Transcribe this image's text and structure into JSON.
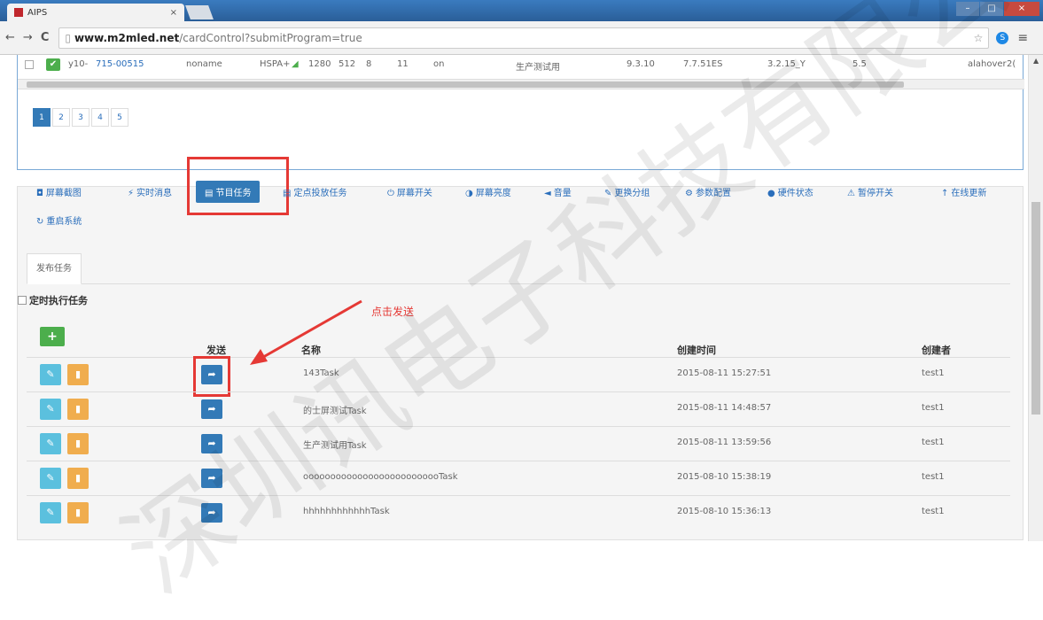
{
  "browser": {
    "tab_title": "AIPS",
    "tab_close": "×",
    "url_domain": "www.m2mled.net",
    "url_path": "/cardControl?submitProgram=true",
    "back": "←",
    "forward": "→",
    "reload": "C",
    "star": "☆",
    "menu": "≡"
  },
  "device_row": {
    "id": "y10-",
    "link": "715-00515",
    "name": "noname",
    "network": "HSPA+",
    "w": "1280",
    "h": "512",
    "n1": "8",
    "n2": "11",
    "state": "on",
    "group": "生产测试用",
    "v1": "9.3.10",
    "v2": "7.7.51ES",
    "v3": "3.2.15_Y",
    "v4": "5.5",
    "user": "alahover",
    "trunc": "2("
  },
  "pager": [
    "1",
    "2",
    "3",
    "4",
    "5"
  ],
  "actions": [
    {
      "icon": "◘",
      "label": "屏幕截图"
    },
    {
      "icon": "⚡",
      "label": "实时消息"
    },
    {
      "icon": "▤",
      "label": "节目任务"
    },
    {
      "icon": "▤",
      "label": "定点投放任务"
    },
    {
      "icon": "⏻",
      "label": "屏幕开关"
    },
    {
      "icon": "◑",
      "label": "屏幕亮度"
    },
    {
      "icon": "◄",
      "label": "音量"
    },
    {
      "icon": "✎",
      "label": "更换分组"
    },
    {
      "icon": "⚙",
      "label": "参数配置"
    },
    {
      "icon": "●",
      "label": "硬件状态"
    },
    {
      "icon": "⚠",
      "label": "暂停开关"
    },
    {
      "icon": "↑",
      "label": "在线更新"
    },
    {
      "icon": "↻",
      "label": "重启系统"
    }
  ],
  "inner_tab": "发布任务",
  "timer_checkbox": "定时执行任务",
  "annotation": "点击发送",
  "table": {
    "add_label": "+",
    "headers": {
      "send": "发送",
      "name": "名称",
      "created": "创建时间",
      "creator": "创建者"
    },
    "rows": [
      {
        "name": "143Task",
        "created": "2015-08-11 15:27:51",
        "creator": "test1"
      },
      {
        "name": "的士屏测试Task",
        "created": "2015-08-11 14:48:57",
        "creator": "test1"
      },
      {
        "name": "生产测试用Task",
        "created": "2015-08-11 13:59:56",
        "creator": "test1"
      },
      {
        "name": "oooooooooooooooooooooooooTask",
        "created": "2015-08-10 15:38:19",
        "creator": "test1"
      },
      {
        "name": "hhhhhhhhhhhhTask",
        "created": "2015-08-10 15:36:13",
        "creator": "test1"
      }
    ]
  },
  "icons": {
    "edit": "✎",
    "delete": "▮",
    "send": "➦",
    "check": "✔"
  },
  "watermark": "深圳讯电子科技有限公司",
  "colors": {
    "primary": "#337ab7",
    "success": "#4cae4c",
    "info": "#5bc0de",
    "warning": "#f0ad4e",
    "highlight": "#e53935"
  }
}
